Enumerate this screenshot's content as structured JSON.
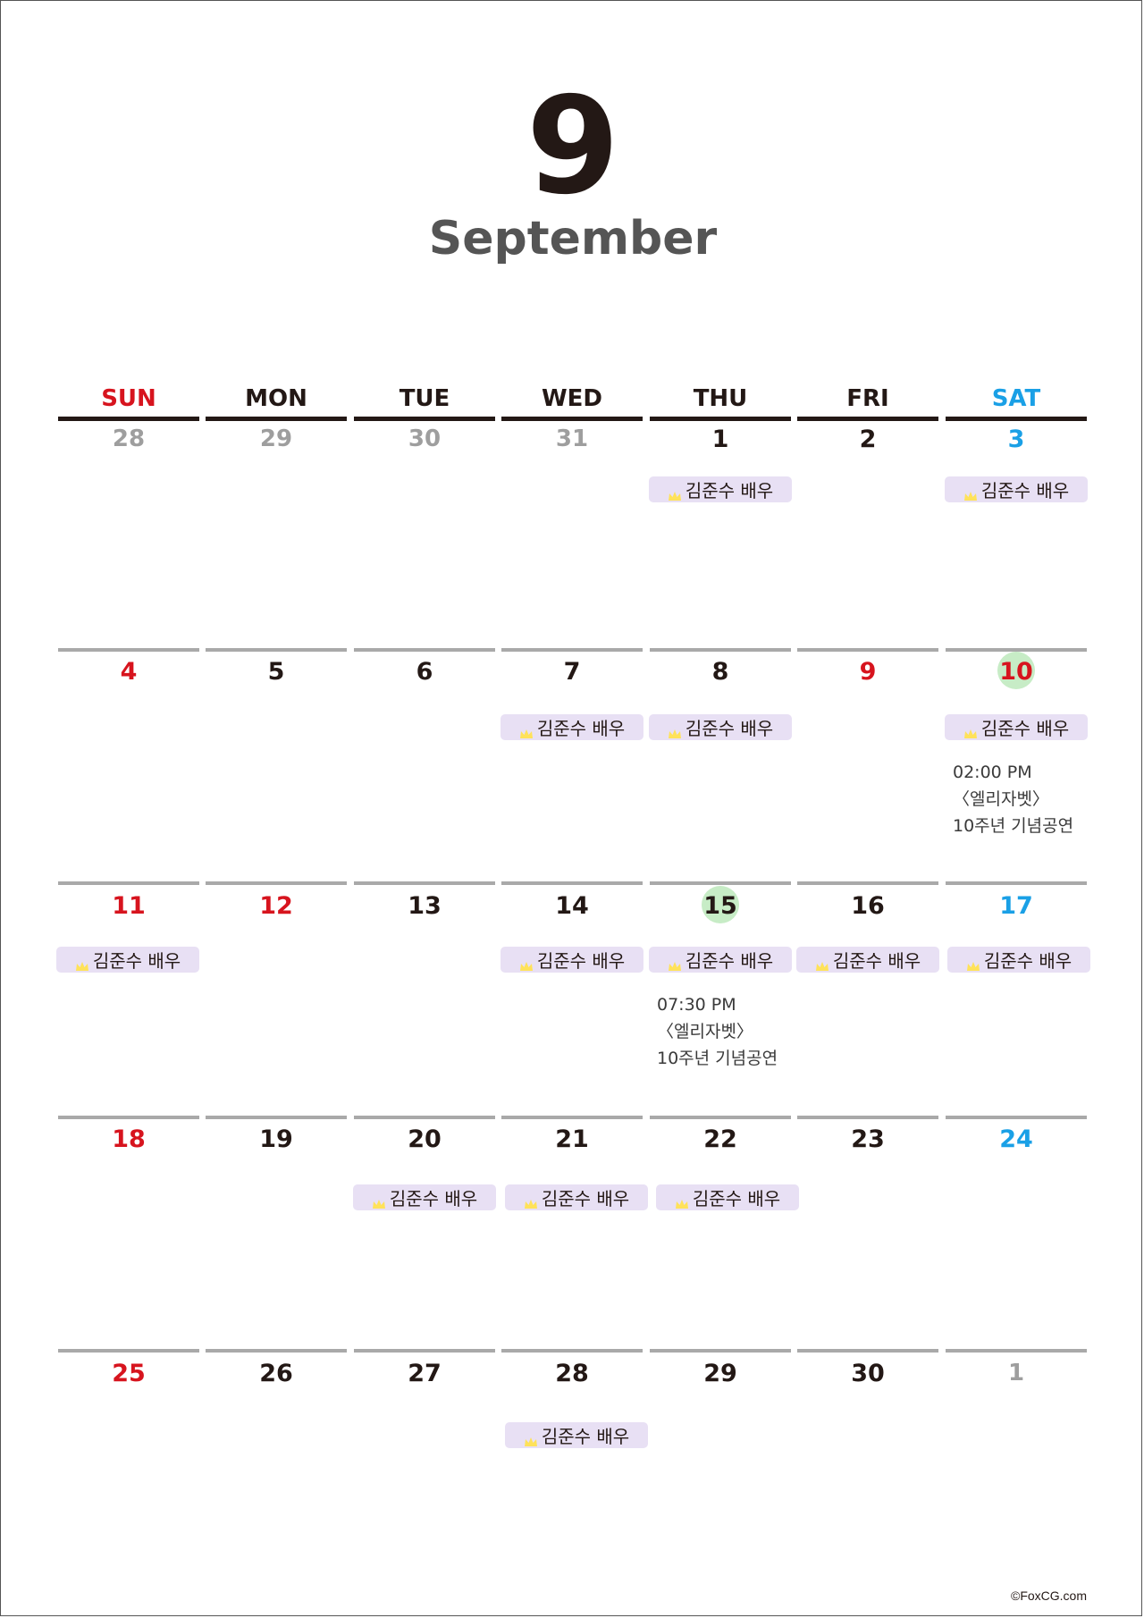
{
  "month": {
    "number": "9",
    "name": "September"
  },
  "colors": {
    "sunday": "#d7141e",
    "saturday": "#1aa0e6",
    "weekday": "#231815",
    "other_month": "#9e9e9e",
    "event_bg": "#e8e0f4",
    "highlight_circle": "#c7ecc6",
    "crown": "#ffe25a"
  },
  "weekdays": [
    "SUN",
    "MON",
    "TUE",
    "WED",
    "THU",
    "FRI",
    "SAT"
  ],
  "event_label": "김준수 배우",
  "event_icon": "crown-icon",
  "weeks": [
    [
      {
        "day": "28",
        "type": "other"
      },
      {
        "day": "29",
        "type": "other"
      },
      {
        "day": "30",
        "type": "other"
      },
      {
        "day": "31",
        "type": "other"
      },
      {
        "day": "1",
        "type": "weekday",
        "event": true
      },
      {
        "day": "2",
        "type": "weekday"
      },
      {
        "day": "3",
        "type": "saturday",
        "event": true
      }
    ],
    [
      {
        "day": "4",
        "type": "sunday"
      },
      {
        "day": "5",
        "type": "weekday"
      },
      {
        "day": "6",
        "type": "weekday"
      },
      {
        "day": "7",
        "type": "weekday",
        "event": true
      },
      {
        "day": "8",
        "type": "weekday",
        "event": true
      },
      {
        "day": "9",
        "type": "sunday"
      },
      {
        "day": "10",
        "type": "sunday",
        "highlight": true,
        "event": true,
        "note": [
          "02:00 PM",
          "〈엘리자벳〉",
          "10주년 기념공연"
        ]
      }
    ],
    [
      {
        "day": "11",
        "type": "sunday",
        "event": true
      },
      {
        "day": "12",
        "type": "sunday"
      },
      {
        "day": "13",
        "type": "weekday"
      },
      {
        "day": "14",
        "type": "weekday",
        "event": true
      },
      {
        "day": "15",
        "type": "weekday",
        "highlight": true,
        "event": true,
        "note": [
          "07:30 PM",
          "〈엘리자벳〉",
          "10주년 기념공연"
        ]
      },
      {
        "day": "16",
        "type": "weekday",
        "event": true
      },
      {
        "day": "17",
        "type": "saturday",
        "event": true
      }
    ],
    [
      {
        "day": "18",
        "type": "sunday"
      },
      {
        "day": "19",
        "type": "weekday"
      },
      {
        "day": "20",
        "type": "weekday",
        "event": true
      },
      {
        "day": "21",
        "type": "weekday",
        "event": true
      },
      {
        "day": "22",
        "type": "weekday",
        "event": true
      },
      {
        "day": "23",
        "type": "weekday"
      },
      {
        "day": "24",
        "type": "saturday"
      }
    ],
    [
      {
        "day": "25",
        "type": "sunday"
      },
      {
        "day": "26",
        "type": "weekday"
      },
      {
        "day": "27",
        "type": "weekday"
      },
      {
        "day": "28",
        "type": "weekday"
      },
      {
        "day": "29",
        "type": "weekday"
      },
      {
        "day": "30",
        "type": "weekday"
      },
      {
        "day": "1",
        "type": "other"
      }
    ]
  ],
  "extra_events": [
    {
      "week": 4,
      "col": 3.45
    }
  ],
  "copyright": "©FoxCG.com"
}
